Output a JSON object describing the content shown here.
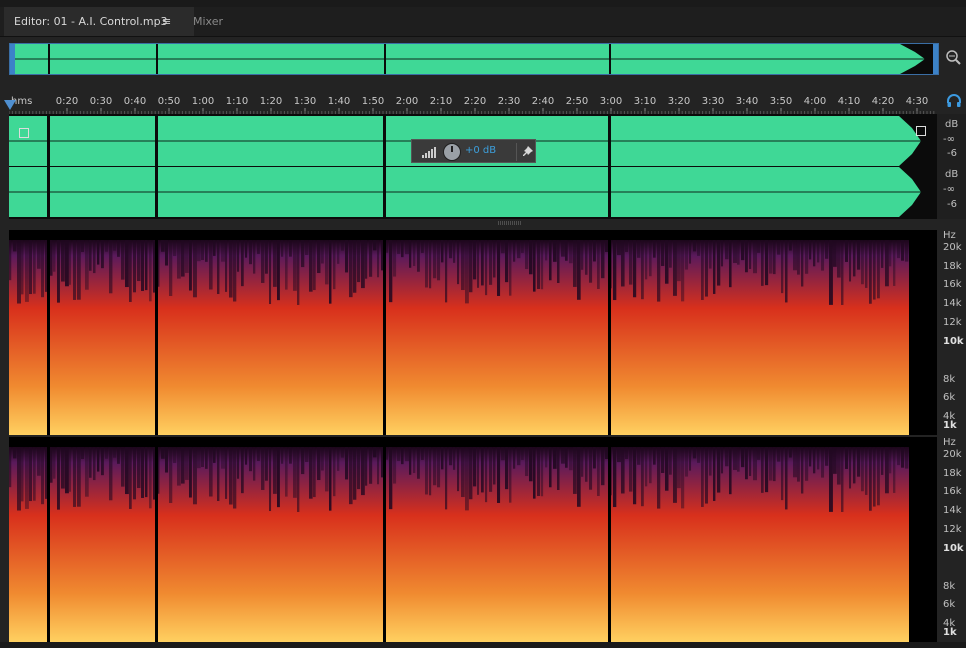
{
  "tabs": {
    "editor_label": "Editor: 01 - A.I. Control.mp3",
    "menu_glyph": "≡",
    "mixer_label": "Mixer"
  },
  "ruler": {
    "unit_label": "hms",
    "ticks": [
      "0:20",
      "0:30",
      "0:40",
      "0:50",
      "1:00",
      "1:10",
      "1:20",
      "1:30",
      "1:40",
      "1:50",
      "2:00",
      "2:10",
      "2:20",
      "2:30",
      "2:40",
      "2:50",
      "3:00",
      "3:10",
      "3:20",
      "3:30",
      "3:40",
      "3:50",
      "4:00",
      "4:10",
      "4:20",
      "4:30"
    ]
  },
  "volume": {
    "value_text": "+0 dB"
  },
  "db_scale": {
    "ch1": {
      "unit": "dB",
      "inf": "-∞",
      "mark": "-6"
    },
    "ch2": {
      "unit": "dB",
      "inf": "-∞",
      "mark": "-6"
    }
  },
  "hz_scale": {
    "unit": "Hz",
    "labels": [
      {
        "text": "20k",
        "bold": false
      },
      {
        "text": "18k",
        "bold": false
      },
      {
        "text": "16k",
        "bold": false
      },
      {
        "text": "14k",
        "bold": false
      },
      {
        "text": "12k",
        "bold": false
      },
      {
        "text": "10k",
        "bold": true
      },
      {
        "text": "8k",
        "bold": false
      },
      {
        "text": "6k",
        "bold": false
      },
      {
        "text": "4k",
        "bold": false
      },
      {
        "text": "1k",
        "bold": true
      }
    ]
  },
  "colors": {
    "waveform": "#3fd896",
    "waveform_edge": "#2a9a68",
    "accent": "#3c82c8",
    "spec_top": "#5a1a5c",
    "spec_mid": "#d8301c",
    "spec_low": "#ffd060"
  },
  "icons": {
    "menu": "menu-icon",
    "zoom": "zoom-icon",
    "headphone": "headphone-icon",
    "pin": "pin-icon"
  }
}
